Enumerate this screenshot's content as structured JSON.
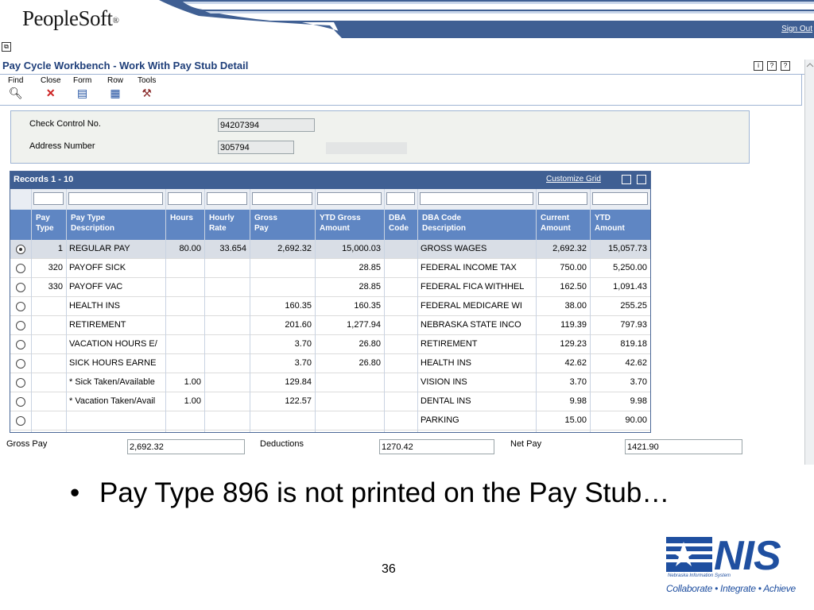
{
  "header": {
    "logo_text": "PeopleSoft",
    "logo_mark": "®",
    "sign_out": "Sign Out",
    "page_title": "Pay Cycle Workbench - Work With Pay Stub Detail",
    "top_right_icons": [
      "info-icon",
      "help-icon",
      "help-search-icon"
    ]
  },
  "toolbar": [
    {
      "label": "Find",
      "icon": "find-icon"
    },
    {
      "label": "Close",
      "icon": "close-icon"
    },
    {
      "label": "Form",
      "icon": "form-icon"
    },
    {
      "label": "Row",
      "icon": "row-icon"
    },
    {
      "label": "Tools",
      "icon": "tools-icon"
    }
  ],
  "form": {
    "check_control_label": "Check Control No.",
    "check_control_value": "94207394",
    "address_number_label": "Address Number",
    "address_number_value": "305794"
  },
  "grid": {
    "title": "Records 1 - 10",
    "customize": "Customize Grid",
    "columns": [
      "Pay\nType",
      "Pay Type\nDescription",
      "Hours",
      "Hourly\nRate",
      "Gross\nPay",
      "YTD Gross\nAmount",
      "DBA\nCode",
      "DBA Code\nDescription",
      "Current\nAmount",
      "YTD\nAmount"
    ],
    "rows": [
      {
        "selected": true,
        "pay_type": "1",
        "desc": "REGULAR PAY",
        "hours": "80.00",
        "rate": "33.654",
        "gross": "2,692.32",
        "ytd_gross": "15,000.03",
        "dba": "",
        "dba_desc": "GROSS WAGES",
        "current": "2,692.32",
        "ytd": "15,057.73"
      },
      {
        "selected": false,
        "pay_type": "320",
        "desc": "PAYOFF SICK",
        "hours": "",
        "rate": "",
        "gross": "",
        "ytd_gross": "28.85",
        "dba": "",
        "dba_desc": "FEDERAL INCOME TAX",
        "current": "750.00",
        "ytd": "5,250.00"
      },
      {
        "selected": false,
        "pay_type": "330",
        "desc": "PAYOFF VAC",
        "hours": "",
        "rate": "",
        "gross": "",
        "ytd_gross": "28.85",
        "dba": "",
        "dba_desc": "FEDERAL FICA WITHHEL",
        "current": "162.50",
        "ytd": "1,091.43"
      },
      {
        "selected": false,
        "pay_type": "",
        "desc": "HEALTH INS",
        "hours": "",
        "rate": "",
        "gross": "160.35",
        "ytd_gross": "160.35",
        "dba": "",
        "dba_desc": "FEDERAL MEDICARE WI",
        "current": "38.00",
        "ytd": "255.25"
      },
      {
        "selected": false,
        "pay_type": "",
        "desc": "RETIREMENT",
        "hours": "",
        "rate": "",
        "gross": "201.60",
        "ytd_gross": "1,277.94",
        "dba": "",
        "dba_desc": "NEBRASKA STATE INCO",
        "current": "119.39",
        "ytd": "797.93"
      },
      {
        "selected": false,
        "pay_type": "",
        "desc": "VACATION HOURS E/",
        "hours": "",
        "rate": "",
        "gross": "3.70",
        "ytd_gross": "26.80",
        "dba": "",
        "dba_desc": "RETIREMENT",
        "current": "129.23",
        "ytd": "819.18"
      },
      {
        "selected": false,
        "pay_type": "",
        "desc": "SICK HOURS EARNE",
        "hours": "",
        "rate": "",
        "gross": "3.70",
        "ytd_gross": "26.80",
        "dba": "",
        "dba_desc": "HEALTH INS",
        "current": "42.62",
        "ytd": "42.62"
      },
      {
        "selected": false,
        "pay_type": "",
        "desc": "* Sick Taken/Available",
        "hours": "1.00",
        "rate": "",
        "gross": "129.84",
        "ytd_gross": "",
        "dba": "",
        "dba_desc": "VISION INS",
        "current": "3.70",
        "ytd": "3.70"
      },
      {
        "selected": false,
        "pay_type": "",
        "desc": "* Vacation Taken/Avail",
        "hours": "1.00",
        "rate": "",
        "gross": "122.57",
        "ytd_gross": "",
        "dba": "",
        "dba_desc": "DENTAL INS",
        "current": "9.98",
        "ytd": "9.98"
      },
      {
        "selected": false,
        "pay_type": "",
        "desc": "",
        "hours": "",
        "rate": "",
        "gross": "",
        "ytd_gross": "",
        "dba": "",
        "dba_desc": "PARKING",
        "current": "15.00",
        "ytd": "90.00"
      }
    ]
  },
  "totals": {
    "gross_label": "Gross Pay",
    "gross_value": "2,692.32",
    "deductions_label": "Deductions",
    "deductions_value": "1270.42",
    "net_label": "Net Pay",
    "net_value": "1421.90"
  },
  "slide": {
    "bullet": "•",
    "text": "Pay Type 896 is not printed on the Pay Stub…",
    "page_number": "36"
  },
  "nis_logo": {
    "name": "NIS",
    "subtitle": "Nebraska Information System",
    "tagline": "Collaborate • Integrate • Achieve"
  },
  "colors": {
    "banner_blue": "#3f5f93",
    "header_blue": "#5f86c3",
    "title_blue": "#1f3f7a",
    "nis_blue": "#1f4fa0"
  }
}
